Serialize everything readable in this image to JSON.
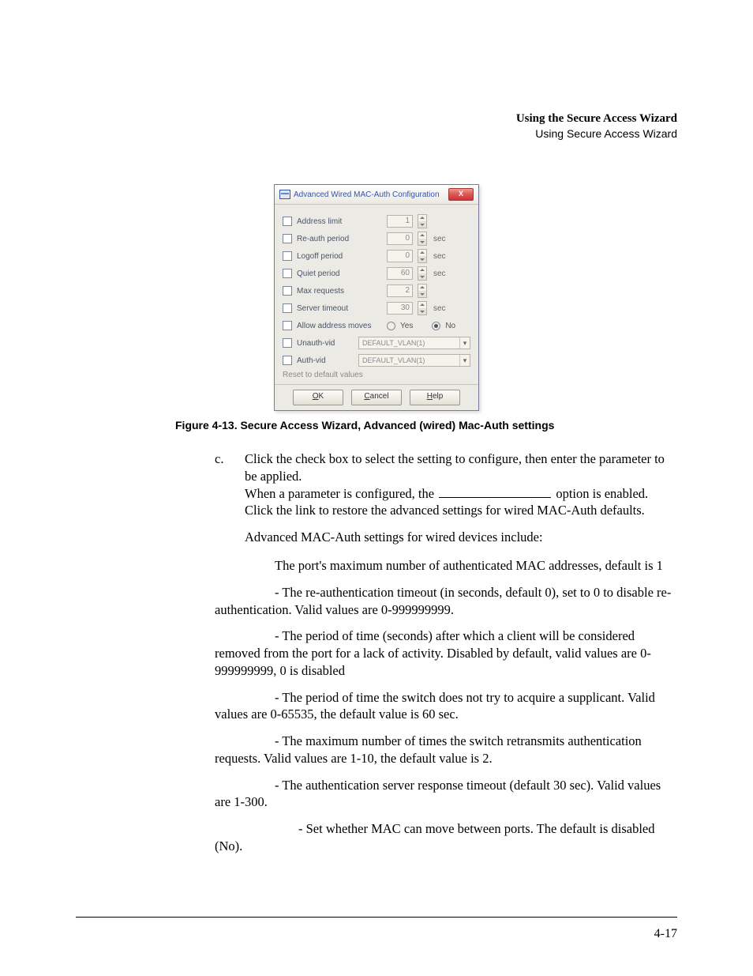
{
  "header": {
    "title": "Using the Secure Access Wizard",
    "subtitle": "Using Secure Access Wizard"
  },
  "dialog": {
    "title": "Advanced Wired MAC-Auth Configuration",
    "rows": {
      "address_limit": {
        "label": "Address limit",
        "value": "1"
      },
      "reauth": {
        "label": "Re-auth period",
        "value": "0",
        "unit": "sec"
      },
      "logoff": {
        "label": "Logoff period",
        "value": "0",
        "unit": "sec"
      },
      "quiet": {
        "label": "Quiet period",
        "value": "60",
        "unit": "sec"
      },
      "maxreq": {
        "label": "Max requests",
        "value": "2"
      },
      "server_to": {
        "label": "Server timeout",
        "value": "30",
        "unit": "sec"
      },
      "allow_moves": {
        "label": "Allow address moves",
        "yes": "Yes",
        "no": "No"
      },
      "unauth": {
        "label": "Unauth-vid",
        "value": "DEFAULT_VLAN(1)"
      },
      "auth": {
        "label": "Auth-vid",
        "value": "DEFAULT_VLAN(1)"
      }
    },
    "reset": "Reset to default values",
    "buttons": {
      "ok": "K",
      "ok_u": "O",
      "cancel": "ancel",
      "cancel_u": "C",
      "help": "elp",
      "help_u": "H"
    }
  },
  "caption": "Figure 4-13. Secure Access Wizard, Advanced (wired) Mac-Auth settings",
  "step_marker": "c.",
  "step_text1": "Click the check box to select the setting to configure, then enter the parameter to be applied.",
  "step_text2a": "When a parameter is configured, the ",
  "step_text2b": " option is enabled. Click the link to restore the advanced settings for wired MAC-Auth defaults.",
  "intro": "Advanced MAC-Auth settings for wired devices include:",
  "bullets": {
    "b1": "The port's maximum number of authenticated MAC addresses, default is 1",
    "b2": "- The re-authentication timeout (in seconds, default 0), set to 0 to disable re-authentication. Valid values are 0-999999999.",
    "b3": "- The period of time (seconds) after which a client will be considered removed from the port for a lack of activity. Disabled by default, valid values are 0-999999999, 0 is disabled",
    "b4": "- The period of time the switch does not try to acquire a supplicant. Valid values are 0-65535, the default value is 60 sec.",
    "b5": "- The maximum number of times the switch retransmits authentication requests. Valid values are 1-10, the default value is 2.",
    "b6": "- The authentication server response timeout (default 30 sec). Valid values are 1-300.",
    "b7": "- Set whether MAC can move between ports. The default is disabled (No)."
  },
  "page_number": "4-17"
}
